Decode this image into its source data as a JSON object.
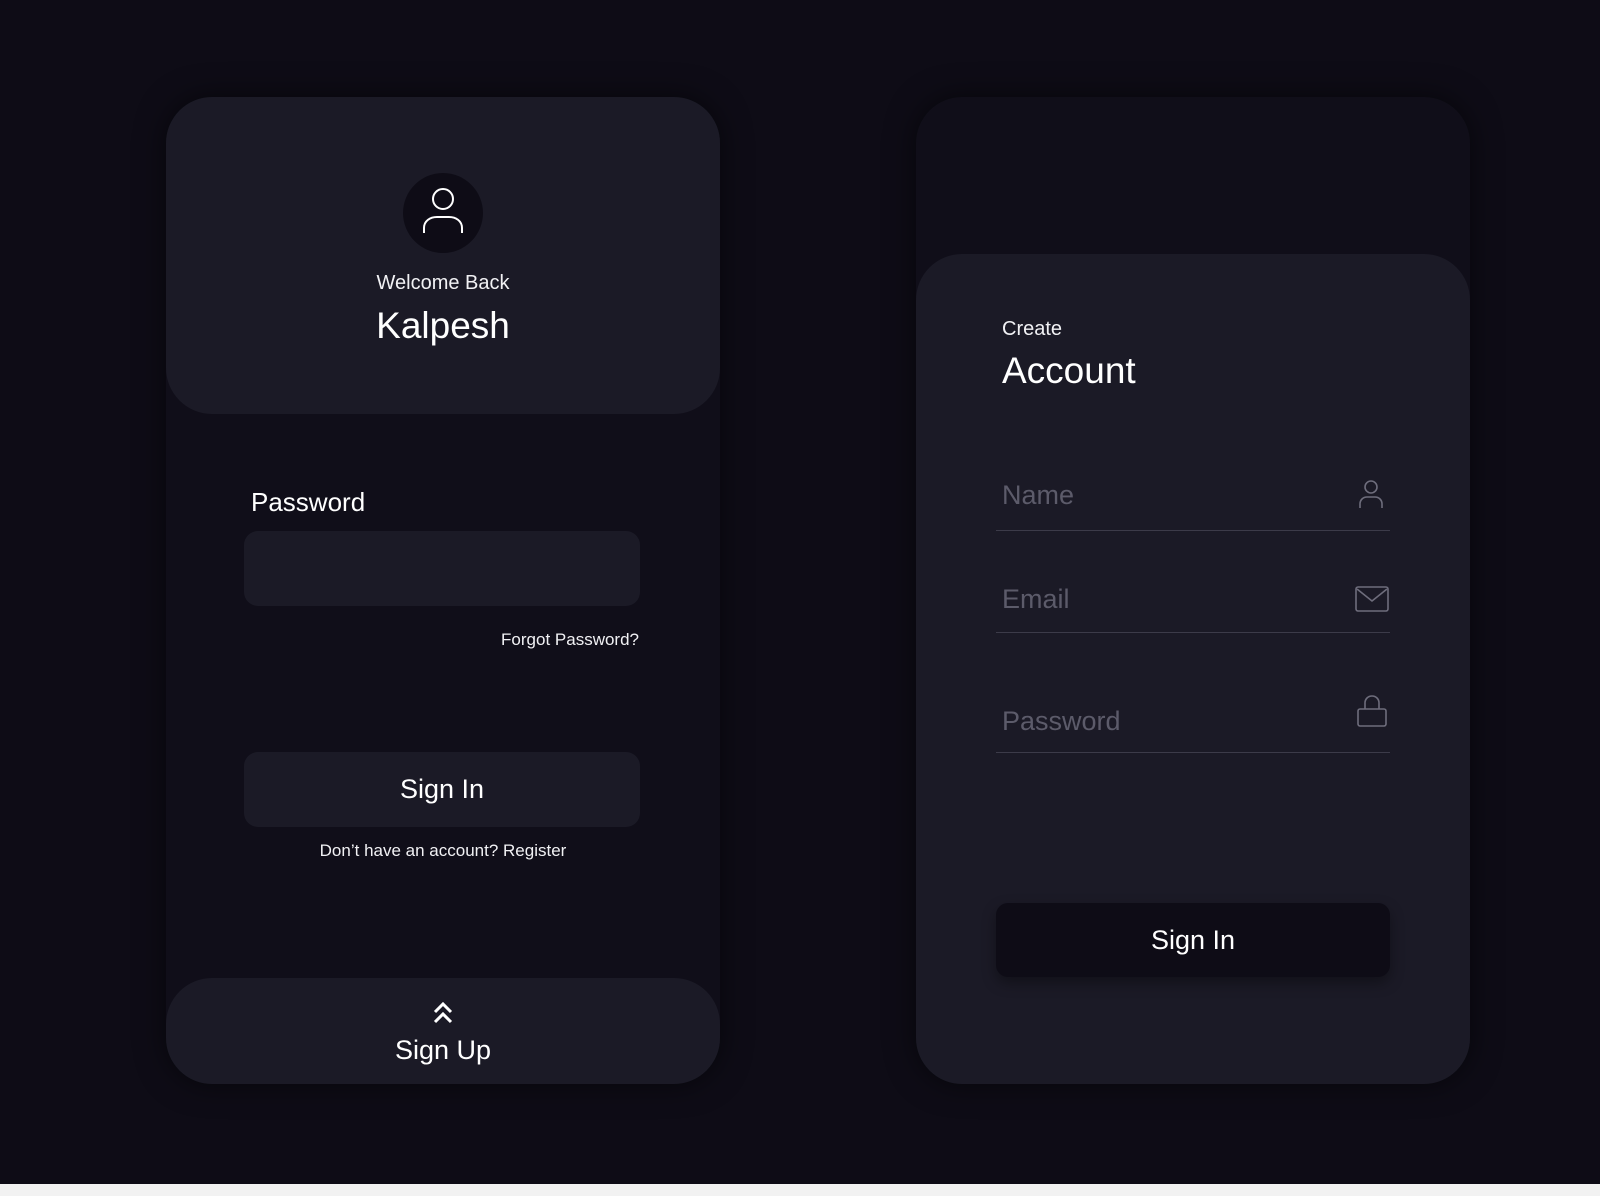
{
  "colors": {
    "background": "#0e0c16",
    "panel": "#1b1a26",
    "text": "#ffffff",
    "placeholder": "#5c5b6a"
  },
  "signin_screen": {
    "welcome_text": "Welcome Back",
    "username": "Kalpesh",
    "password_label": "Password",
    "password_value": "",
    "forgot_link": "Forgot Password?",
    "signin_button": "Sign In",
    "register_prompt": "Don’t have an account?",
    "register_link": "Register",
    "signup_label": "Sign Up",
    "icons": {
      "avatar": "user-icon",
      "signup": "double-chevron-up-icon"
    }
  },
  "create_account_screen": {
    "heading_small": "Create",
    "heading_large": "Account",
    "fields": {
      "name": {
        "placeholder": "Name",
        "icon": "user-icon"
      },
      "email": {
        "placeholder": "Email",
        "icon": "mail-icon"
      },
      "password": {
        "placeholder": "Password",
        "icon": "lock-icon"
      }
    },
    "signin_button": "Sign In"
  }
}
